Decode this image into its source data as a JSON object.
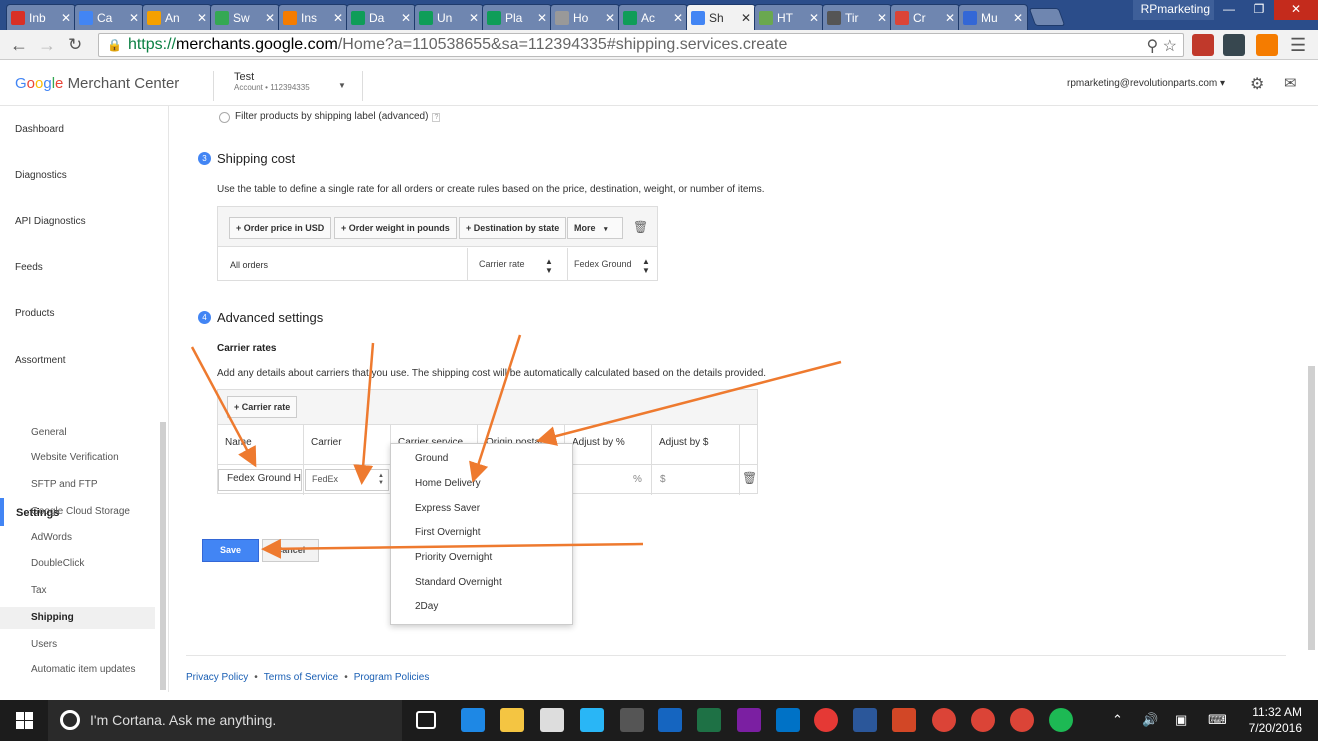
{
  "browser": {
    "tabs": [
      {
        "label": "Inb",
        "color": "#d93025"
      },
      {
        "label": "Ca",
        "color": "#4285f4"
      },
      {
        "label": "An",
        "color": "#f4a000"
      },
      {
        "label": "Sw",
        "color": "#34a853"
      },
      {
        "label": "Ins",
        "color": "#f57c00"
      },
      {
        "label": "Da",
        "color": "#0f9d58"
      },
      {
        "label": "Un",
        "color": "#0f9d58"
      },
      {
        "label": "Pla",
        "color": "#0f9d58"
      },
      {
        "label": "Ho",
        "color": "#999999"
      },
      {
        "label": "Ac",
        "color": "#0f9d58"
      },
      {
        "label": "Sh",
        "color": "#4285f4",
        "active": true
      },
      {
        "label": "HT",
        "color": "#6aa84f"
      },
      {
        "label": "Tir",
        "color": "#555555"
      },
      {
        "label": "Cr",
        "color": "#db4437"
      },
      {
        "label": "Mu",
        "color": "#3367d6"
      }
    ],
    "profile": "RPmarketing",
    "url_https": "https://",
    "url_host": "merchants.google.com",
    "url_path": "/Home?a=110538655&sa=112394335#shipping.services.create"
  },
  "header": {
    "logo_google": [
      "G",
      "o",
      "o",
      "g",
      "l",
      "e"
    ],
    "logo_product": "Merchant Center",
    "account_name": "Test",
    "account_sub_label": "Account",
    "account_bullet": "•",
    "account_id": "112394335",
    "user_email": "rpmarketing@revolutionparts.com"
  },
  "sidebar": {
    "items": [
      "Dashboard",
      "Diagnostics",
      "API Diagnostics",
      "Feeds",
      "Products",
      "Assortment",
      "Settings"
    ],
    "subitems": [
      "General",
      "Website Verification",
      "SFTP and FTP",
      "Google Cloud Storage",
      "AdWords",
      "DoubleClick",
      "Tax",
      "Shipping",
      "Users",
      "Automatic item updates"
    ],
    "active_sub": "Shipping"
  },
  "main": {
    "filter_label": "Filter products by shipping label (advanced)",
    "step3_num": "3",
    "step3_title": "Shipping cost",
    "step3_desc": "Use the table to define a single rate for all orders or create rules based on the price, destination, weight, or number of items.",
    "cost_buttons": [
      "+ Order price in USD",
      "+ Order weight in pounds",
      "+ Destination by state",
      "More"
    ],
    "all_orders": "All orders",
    "rate_type": "Carrier rate",
    "rate_service": "Fedex Ground",
    "step4_num": "4",
    "step4_title": "Advanced settings",
    "carrier_rates_title": "Carrier rates",
    "carrier_rates_desc": "Add any details about carriers that you use. The shipping cost will be automatically calculated based on the details provided.",
    "add_carrier_rate": "+ Carrier rate",
    "columns": [
      "Name",
      "Carrier",
      "Carrier service",
      "Origin postal",
      "Adjust by %",
      "Adjust by $"
    ],
    "row": {
      "name": "Fedex Ground H",
      "carrier": "FedEx",
      "pct_suffix": "%",
      "dollar_prefix": "$"
    },
    "dropdown_options": [
      "Ground",
      "Home Delivery",
      "Express Saver",
      "First Overnight",
      "Priority Overnight",
      "Standard Overnight",
      "2Day"
    ],
    "save": "Save",
    "cancel": "Cancel"
  },
  "footer": {
    "links": [
      "Privacy Policy",
      "Terms of Service",
      "Program Policies"
    ],
    "separator": "•"
  },
  "taskbar": {
    "cortana": "I'm Cortana. Ask me anything.",
    "time": "11:32 AM",
    "date": "7/20/2016"
  },
  "colors": {
    "accent": "#4285f4",
    "annotation_arrow": "#ee7a2f"
  }
}
